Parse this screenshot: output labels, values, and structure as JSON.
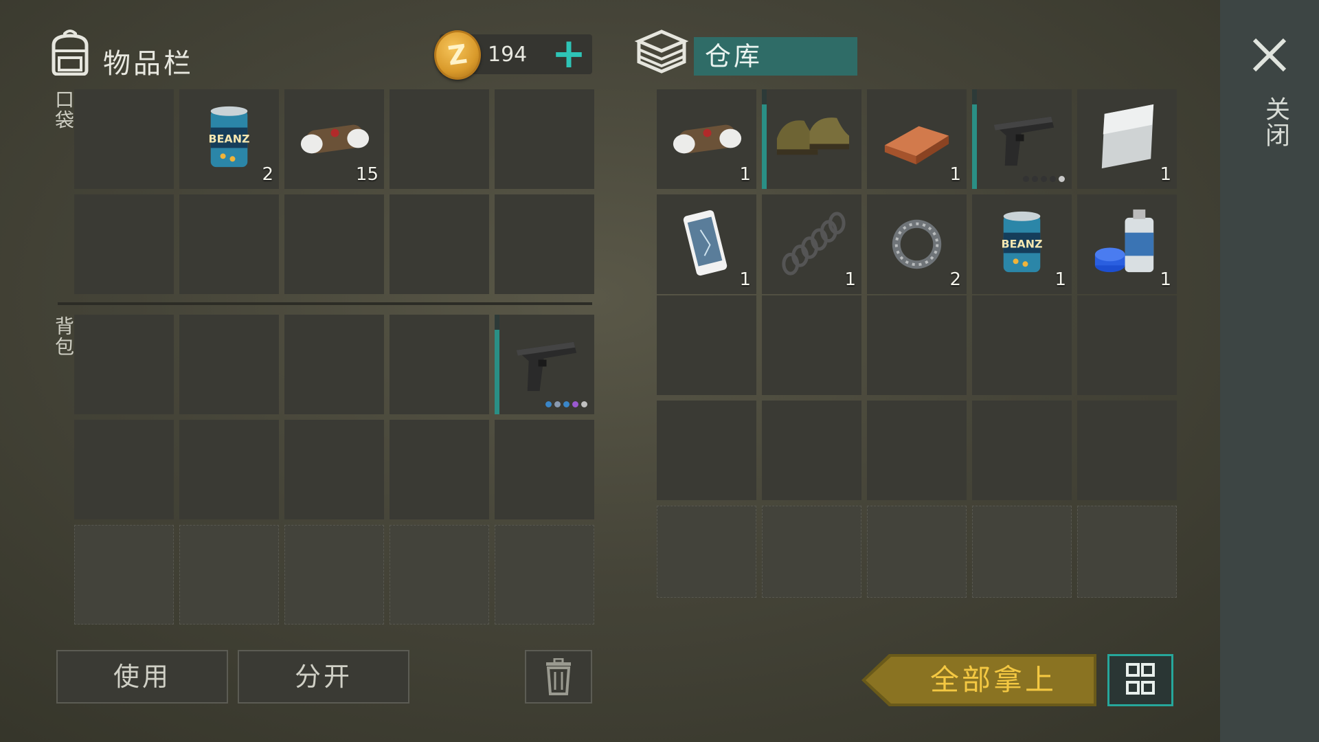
{
  "inventory": {
    "title": "物品栏",
    "coins": "194",
    "pocket_label": "口袋",
    "backpack_label": "背包",
    "pocket_slots": [
      {
        "item": "",
        "qty": ""
      },
      {
        "item": "beans-can-icon",
        "qty": "2"
      },
      {
        "item": "bandage-icon",
        "qty": "15"
      },
      {
        "item": "",
        "qty": ""
      },
      {
        "item": "",
        "qty": ""
      },
      {
        "item": "",
        "qty": ""
      },
      {
        "item": "",
        "qty": ""
      },
      {
        "item": "",
        "qty": ""
      },
      {
        "item": "",
        "qty": ""
      },
      {
        "item": "",
        "qty": ""
      }
    ],
    "backpack_slots": [
      {
        "item": "",
        "qty": ""
      },
      {
        "item": "",
        "qty": ""
      },
      {
        "item": "",
        "qty": ""
      },
      {
        "item": "",
        "qty": ""
      },
      {
        "item": "pistol-icon",
        "qty": ""
      },
      {
        "item": "",
        "qty": ""
      },
      {
        "item": "",
        "qty": ""
      },
      {
        "item": "",
        "qty": ""
      },
      {
        "item": "",
        "qty": ""
      },
      {
        "item": "",
        "qty": ""
      }
    ]
  },
  "storage": {
    "title": "仓库",
    "slots": [
      {
        "item": "bandage-icon",
        "qty": "1"
      },
      {
        "item": "boots-icon",
        "qty": ""
      },
      {
        "item": "copper-bar-icon",
        "qty": "1"
      },
      {
        "item": "pistol-icon",
        "qty": ""
      },
      {
        "item": "metal-sheet-icon",
        "qty": "1"
      },
      {
        "item": "phone-icon",
        "qty": "1"
      },
      {
        "item": "spring-icon",
        "qty": "1"
      },
      {
        "item": "bearing-icon",
        "qty": "2"
      },
      {
        "item": "beans-can-icon",
        "qty": "1"
      },
      {
        "item": "spray-paint-icon",
        "qty": "1"
      }
    ]
  },
  "buttons": {
    "use": "使用",
    "split": "分开",
    "take_all": "全部拿上",
    "close": "关闭"
  },
  "colors": {
    "accent_teal": "#2ec4b6",
    "storage_tab": "#2f6c67",
    "take_all_gold": "#f4c842"
  }
}
